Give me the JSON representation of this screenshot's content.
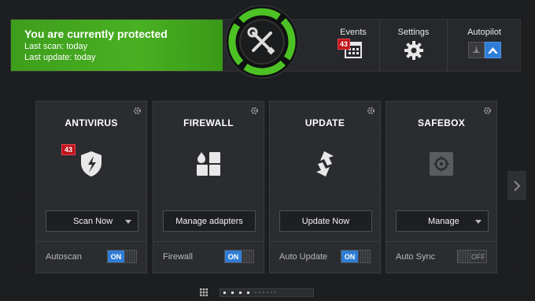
{
  "status": {
    "title": "You are currently protected",
    "last_scan": "Last scan: today",
    "last_update": "Last update: today"
  },
  "header": {
    "events_label": "Events",
    "events_count": "43",
    "settings_label": "Settings",
    "autopilot_label": "Autopilot"
  },
  "cards": [
    {
      "title": "ANTIVIRUS",
      "badge": "43",
      "button": "Scan Now",
      "footer_label": "Autoscan",
      "toggle": "ON"
    },
    {
      "title": "FIREWALL",
      "button": "Manage adapters",
      "footer_label": "Firewall",
      "toggle": "ON"
    },
    {
      "title": "UPDATE",
      "button": "Update Now",
      "footer_label": "Auto Update",
      "toggle": "ON"
    },
    {
      "title": "SAFEBOX",
      "button": "Manage",
      "footer_label": "Auto Sync",
      "toggle": "OFF"
    }
  ],
  "colors": {
    "status_green": "#49b022",
    "accent_blue": "#2f7dd6",
    "badge_red": "#c0131a"
  },
  "icons": [
    "tools-icon",
    "calendar-icon",
    "gear-icon",
    "autopilot-icon",
    "shield-icon",
    "firewall-icon",
    "update-arrows-icon",
    "safebox-icon",
    "chevron-right-icon",
    "grid-icon"
  ]
}
